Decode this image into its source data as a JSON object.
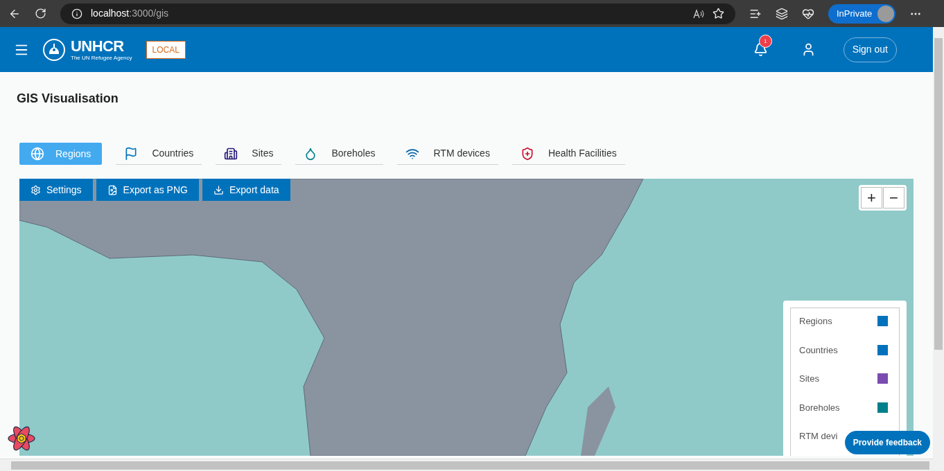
{
  "browser": {
    "url": "**localhost**:3000/gis",
    "profile": "InPrivate"
  },
  "header": {
    "logo_text": "UNHCR",
    "logo_subtitle": "The UN Refugee Agency",
    "env_badge": "LOCAL",
    "notification_count": "1",
    "sign_out": "Sign out"
  },
  "page": {
    "title": "GIS Visualisation"
  },
  "tabs": [
    {
      "label": "Regions",
      "kind": "globe",
      "selected": true
    },
    {
      "label": "Countries",
      "kind": "flag",
      "selected": false
    },
    {
      "label": "Sites",
      "kind": "building",
      "selected": false
    },
    {
      "label": "Boreholes",
      "kind": "drop",
      "selected": false
    },
    {
      "label": "RTM devices",
      "kind": "signal",
      "selected": false
    },
    {
      "label": "Health Facilities",
      "kind": "health",
      "selected": false
    }
  ],
  "toolbar": [
    {
      "label": "Settings",
      "kind": "settings"
    },
    {
      "label": "Export as PNG",
      "kind": "png"
    },
    {
      "label": "Export data",
      "kind": "download"
    }
  ],
  "zoom": {
    "in": "+",
    "out": "−"
  },
  "legend": [
    {
      "label": "Regions",
      "color": "#0072bc"
    },
    {
      "label": "Countries",
      "color": "#0072bc"
    },
    {
      "label": "Sites",
      "color": "#7b4bb0"
    },
    {
      "label": "Boreholes",
      "color": "#00808a"
    },
    {
      "label": "RTM devi"
    }
  ],
  "feedback": "Provide feedback"
}
